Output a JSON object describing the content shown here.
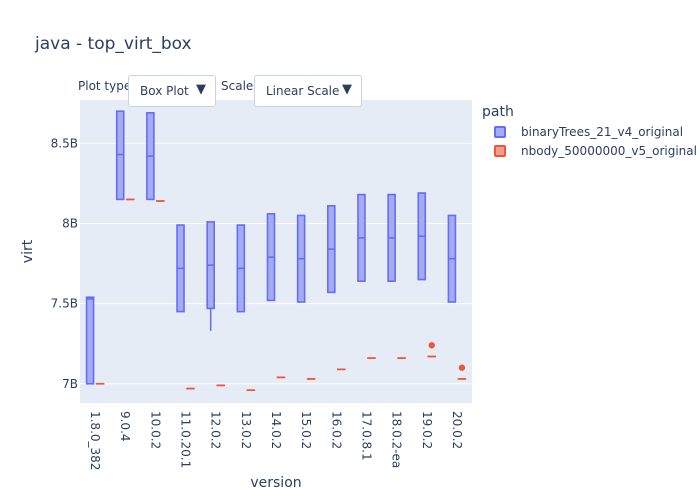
{
  "title": "java - top_virt_box",
  "controls": {
    "plot_type_label": "Plot type",
    "plot_type_value": "Box Plot",
    "scale_label": "Scale:",
    "scale_value": "Linear Scale",
    "arrow_glyph": "▼"
  },
  "legend": {
    "title": "path",
    "items": [
      "binaryTrees_21_v4_original",
      "nbody_50000000_v5_original"
    ]
  },
  "colors": {
    "plot_bg": "#e5ecf6",
    "grid": "#ffffff",
    "series1_line": "#636efa",
    "series1_fill": "#a6abf0",
    "series2_line": "#ef553b",
    "series2_fill": "#f39e8c"
  },
  "chart_data": {
    "type": "box",
    "title": "java - top_virt_box",
    "xlabel": "version",
    "ylabel": "virt",
    "categories": [
      "1.8.0_382",
      "9.0.4",
      "10.0.2",
      "11.0.20.1",
      "12.0.2",
      "13.0.2",
      "14.0.2",
      "15.0.2",
      "16.0.2",
      "17.0.8.1",
      "18.0.2-ea",
      "19.0.2",
      "20.0.2"
    ],
    "ylim": [
      6.88,
      8.77
    ],
    "yticks": [
      7,
      7.5,
      8,
      8.5
    ],
    "yticklabels": [
      "7B",
      "7.5B",
      "8B",
      "8.5B"
    ],
    "grid": true,
    "legend_position": "top-right",
    "series": [
      {
        "name": "binaryTrees_21_v4_original",
        "boxes": [
          {
            "q1": 7.0,
            "median": 7.53,
            "q3": 7.54,
            "whisker_low": 7.0,
            "whisker_high": 7.54,
            "outliers": []
          },
          {
            "q1": 8.15,
            "median": 8.43,
            "q3": 8.7,
            "whisker_low": 8.15,
            "whisker_high": 8.7,
            "outliers": []
          },
          {
            "q1": 8.15,
            "median": 8.42,
            "q3": 8.69,
            "whisker_low": 8.15,
            "whisker_high": 8.69,
            "outliers": []
          },
          {
            "q1": 7.45,
            "median": 7.72,
            "q3": 7.99,
            "whisker_low": 7.45,
            "whisker_high": 7.99,
            "outliers": []
          },
          {
            "q1": 7.47,
            "median": 7.74,
            "q3": 8.01,
            "whisker_low": 7.33,
            "whisker_high": 8.01,
            "outliers": []
          },
          {
            "q1": 7.45,
            "median": 7.72,
            "q3": 7.99,
            "whisker_low": 7.45,
            "whisker_high": 7.99,
            "outliers": []
          },
          {
            "q1": 7.52,
            "median": 7.79,
            "q3": 8.06,
            "whisker_low": 7.52,
            "whisker_high": 8.06,
            "outliers": []
          },
          {
            "q1": 7.51,
            "median": 7.78,
            "q3": 8.05,
            "whisker_low": 7.51,
            "whisker_high": 8.05,
            "outliers": []
          },
          {
            "q1": 7.57,
            "median": 7.84,
            "q3": 8.11,
            "whisker_low": 7.57,
            "whisker_high": 8.11,
            "outliers": []
          },
          {
            "q1": 7.64,
            "median": 7.91,
            "q3": 8.18,
            "whisker_low": 7.64,
            "whisker_high": 8.18,
            "outliers": []
          },
          {
            "q1": 7.64,
            "median": 7.91,
            "q3": 8.18,
            "whisker_low": 7.64,
            "whisker_high": 8.18,
            "outliers": []
          },
          {
            "q1": 7.65,
            "median": 7.92,
            "q3": 8.19,
            "whisker_low": 7.65,
            "whisker_high": 8.19,
            "outliers": []
          },
          {
            "q1": 7.51,
            "median": 7.78,
            "q3": 8.05,
            "whisker_low": 7.51,
            "whisker_high": 8.05,
            "outliers": []
          }
        ]
      },
      {
        "name": "nbody_50000000_v5_original",
        "boxes": [
          {
            "q1": 7.0,
            "median": 7.0,
            "q3": 7.0,
            "whisker_low": 7.0,
            "whisker_high": 7.0,
            "outliers": []
          },
          {
            "q1": 8.15,
            "median": 8.15,
            "q3": 8.15,
            "whisker_low": 8.15,
            "whisker_high": 8.15,
            "outliers": []
          },
          {
            "q1": 8.14,
            "median": 8.14,
            "q3": 8.14,
            "whisker_low": 8.14,
            "whisker_high": 8.14,
            "outliers": []
          },
          {
            "q1": 6.97,
            "median": 6.97,
            "q3": 6.97,
            "whisker_low": 6.97,
            "whisker_high": 6.97,
            "outliers": []
          },
          {
            "q1": 6.99,
            "median": 6.99,
            "q3": 6.99,
            "whisker_low": 6.99,
            "whisker_high": 6.99,
            "outliers": []
          },
          {
            "q1": 6.96,
            "median": 6.96,
            "q3": 6.96,
            "whisker_low": 6.96,
            "whisker_high": 6.96,
            "outliers": []
          },
          {
            "q1": 7.04,
            "median": 7.04,
            "q3": 7.04,
            "whisker_low": 7.04,
            "whisker_high": 7.04,
            "outliers": []
          },
          {
            "q1": 7.03,
            "median": 7.03,
            "q3": 7.03,
            "whisker_low": 7.03,
            "whisker_high": 7.03,
            "outliers": []
          },
          {
            "q1": 7.09,
            "median": 7.09,
            "q3": 7.09,
            "whisker_low": 7.09,
            "whisker_high": 7.09,
            "outliers": []
          },
          {
            "q1": 7.16,
            "median": 7.16,
            "q3": 7.16,
            "whisker_low": 7.16,
            "whisker_high": 7.16,
            "outliers": []
          },
          {
            "q1": 7.16,
            "median": 7.16,
            "q3": 7.16,
            "whisker_low": 7.16,
            "whisker_high": 7.16,
            "outliers": []
          },
          {
            "q1": 7.17,
            "median": 7.17,
            "q3": 7.17,
            "whisker_low": 7.17,
            "whisker_high": 7.17,
            "outliers": [
              7.24
            ]
          },
          {
            "q1": 7.03,
            "median": 7.03,
            "q3": 7.03,
            "whisker_low": 7.03,
            "whisker_high": 7.03,
            "outliers": [
              7.1
            ]
          }
        ]
      }
    ]
  }
}
